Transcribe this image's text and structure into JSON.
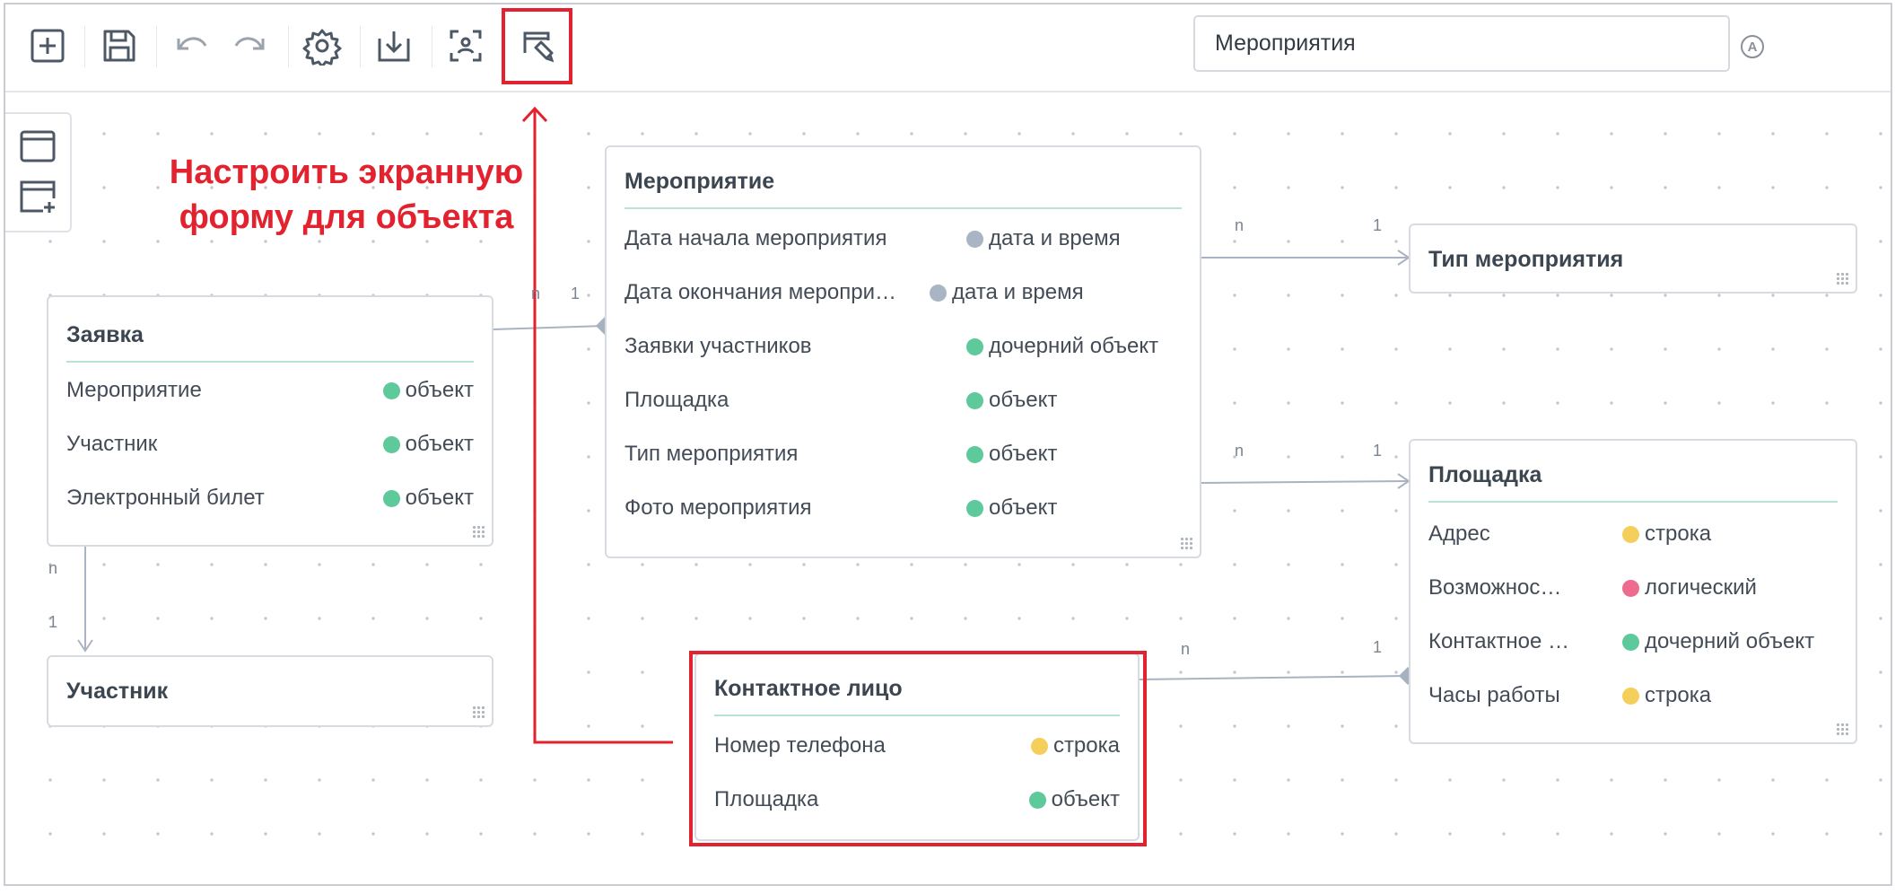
{
  "toolbar": {
    "buttons": [
      {
        "id": "add",
        "icon": "plus-square-icon"
      },
      {
        "id": "save",
        "icon": "floppy-icon"
      },
      {
        "id": "undo",
        "icon": "undo-icon"
      },
      {
        "id": "redo",
        "icon": "redo-icon"
      },
      {
        "id": "settings",
        "icon": "gear-icon"
      },
      {
        "id": "download",
        "icon": "download-icon"
      },
      {
        "id": "scan",
        "icon": "scan-icon"
      },
      {
        "id": "screen-form",
        "icon": "form-edit-icon"
      }
    ],
    "search_value": "Мероприятия",
    "auto_badge": "A"
  },
  "callout": {
    "line1": "Настроить экранную",
    "line2": "форму для объекта"
  },
  "cards": {
    "zayavka": {
      "title": "Заявка",
      "fields": [
        {
          "name": "Мероприятие",
          "type": "объект",
          "color": "#5ec99a"
        },
        {
          "name": "Участник",
          "type": "объект",
          "color": "#5ec99a"
        },
        {
          "name": "Электронный билет",
          "type": "объект",
          "color": "#5ec99a"
        }
      ]
    },
    "uchastnik": {
      "title": "Участник"
    },
    "meropriyatie": {
      "title": "Мероприятие",
      "fields": [
        {
          "name": "Дата начала мероприятия",
          "type": "дата и время",
          "color": "#a9b4c4"
        },
        {
          "name": "Дата окончания меропри…",
          "type": "дата и время",
          "color": "#a9b4c4"
        },
        {
          "name": "Заявки участников",
          "type": "дочерний объект",
          "color": "#5ec99a"
        },
        {
          "name": "Площадка",
          "type": "объект",
          "color": "#5ec99a"
        },
        {
          "name": "Тип мероприятия",
          "type": "объект",
          "color": "#5ec99a"
        },
        {
          "name": "Фото мероприятия",
          "type": "объект",
          "color": "#5ec99a"
        }
      ]
    },
    "tip": {
      "title": "Тип мероприятия"
    },
    "ploshchadka": {
      "title": "Площадка",
      "fields": [
        {
          "name": "Адрес",
          "type": "строка",
          "color": "#f5cf5b"
        },
        {
          "name": "Возможнос…",
          "type": "логический",
          "color": "#ee6a8f"
        },
        {
          "name": "Контактное …",
          "type": "дочерний объект",
          "color": "#5ec99a"
        },
        {
          "name": "Часы работы",
          "type": "строка",
          "color": "#f5cf5b"
        }
      ]
    },
    "kontakt": {
      "title": "Контактное лицо",
      "fields": [
        {
          "name": "Номер телефона",
          "type": "строка",
          "color": "#f5cf5b"
        },
        {
          "name": "Площадка",
          "type": "объект",
          "color": "#5ec99a"
        }
      ]
    }
  },
  "relations": {
    "zayavka_meropriyatie": {
      "from": "n",
      "to": "1"
    },
    "meropriyatie_tip": {
      "from": "n",
      "to": "1"
    },
    "meropriyatie_ploshchadka": {
      "from": "n",
      "to": "1"
    },
    "zayavka_uchastnik": {
      "from": "n",
      "to": "1"
    },
    "kontakt_ploshchadka": {
      "from": "n",
      "to": "1"
    }
  },
  "colors": {
    "accent_red": "#e2222e",
    "connector": "#aab3c1",
    "title_underline": "#b7e3d2"
  }
}
